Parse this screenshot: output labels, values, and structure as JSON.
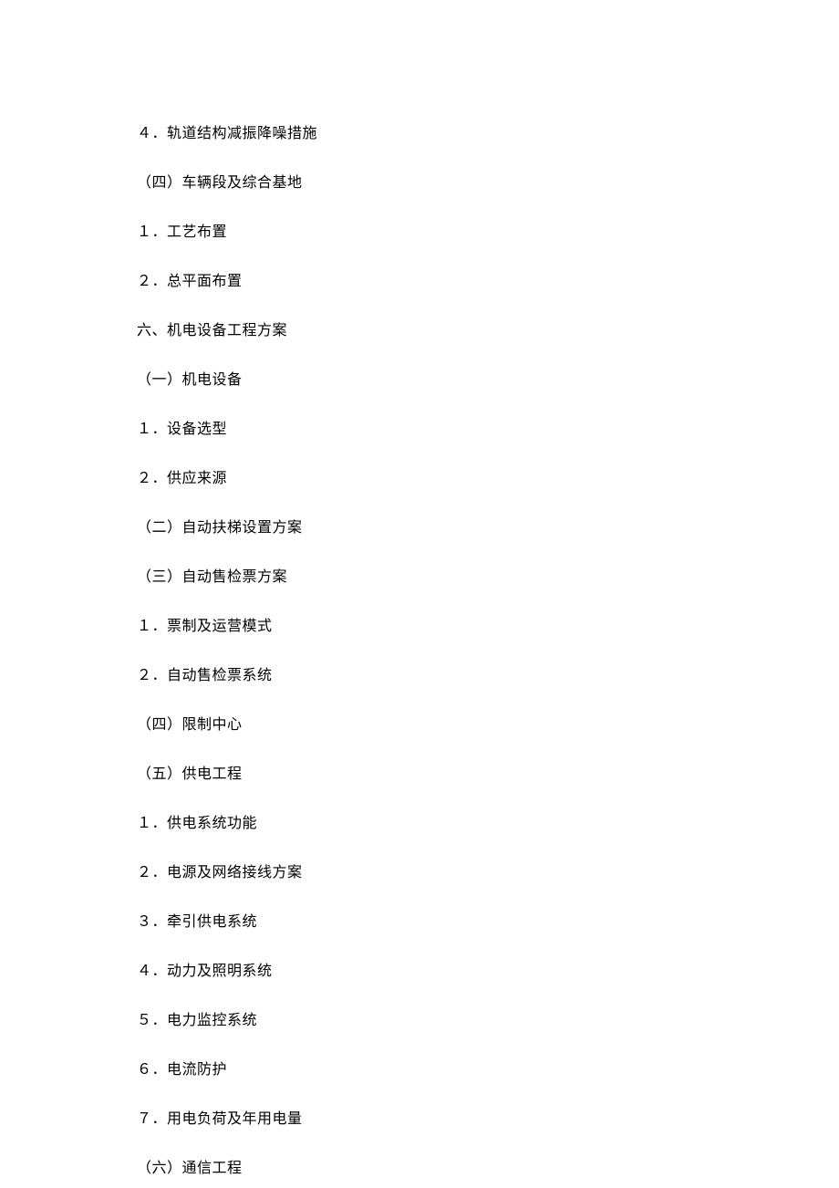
{
  "lines": [
    "４．轨道结构减振降噪措施",
    "（四）车辆段及综合基地",
    "１．工艺布置",
    "２．总平面布置",
    "六、机电设备工程方案",
    "（一）机电设备",
    "１．设备选型",
    "２．供应来源",
    "（二）自动扶梯设置方案",
    "（三）自动售检票方案",
    "１．票制及运营模式",
    "２．自动售检票系统",
    "（四）限制中心",
    "（五）供电工程",
    "１．供电系统功能",
    "２．电源及网络接线方案",
    "３．牵引供电系统",
    "４．动力及照明系统",
    "５．电力监控系统",
    "６．电流防护",
    "７．用电负荷及年用电量",
    "（六）通信工程"
  ]
}
